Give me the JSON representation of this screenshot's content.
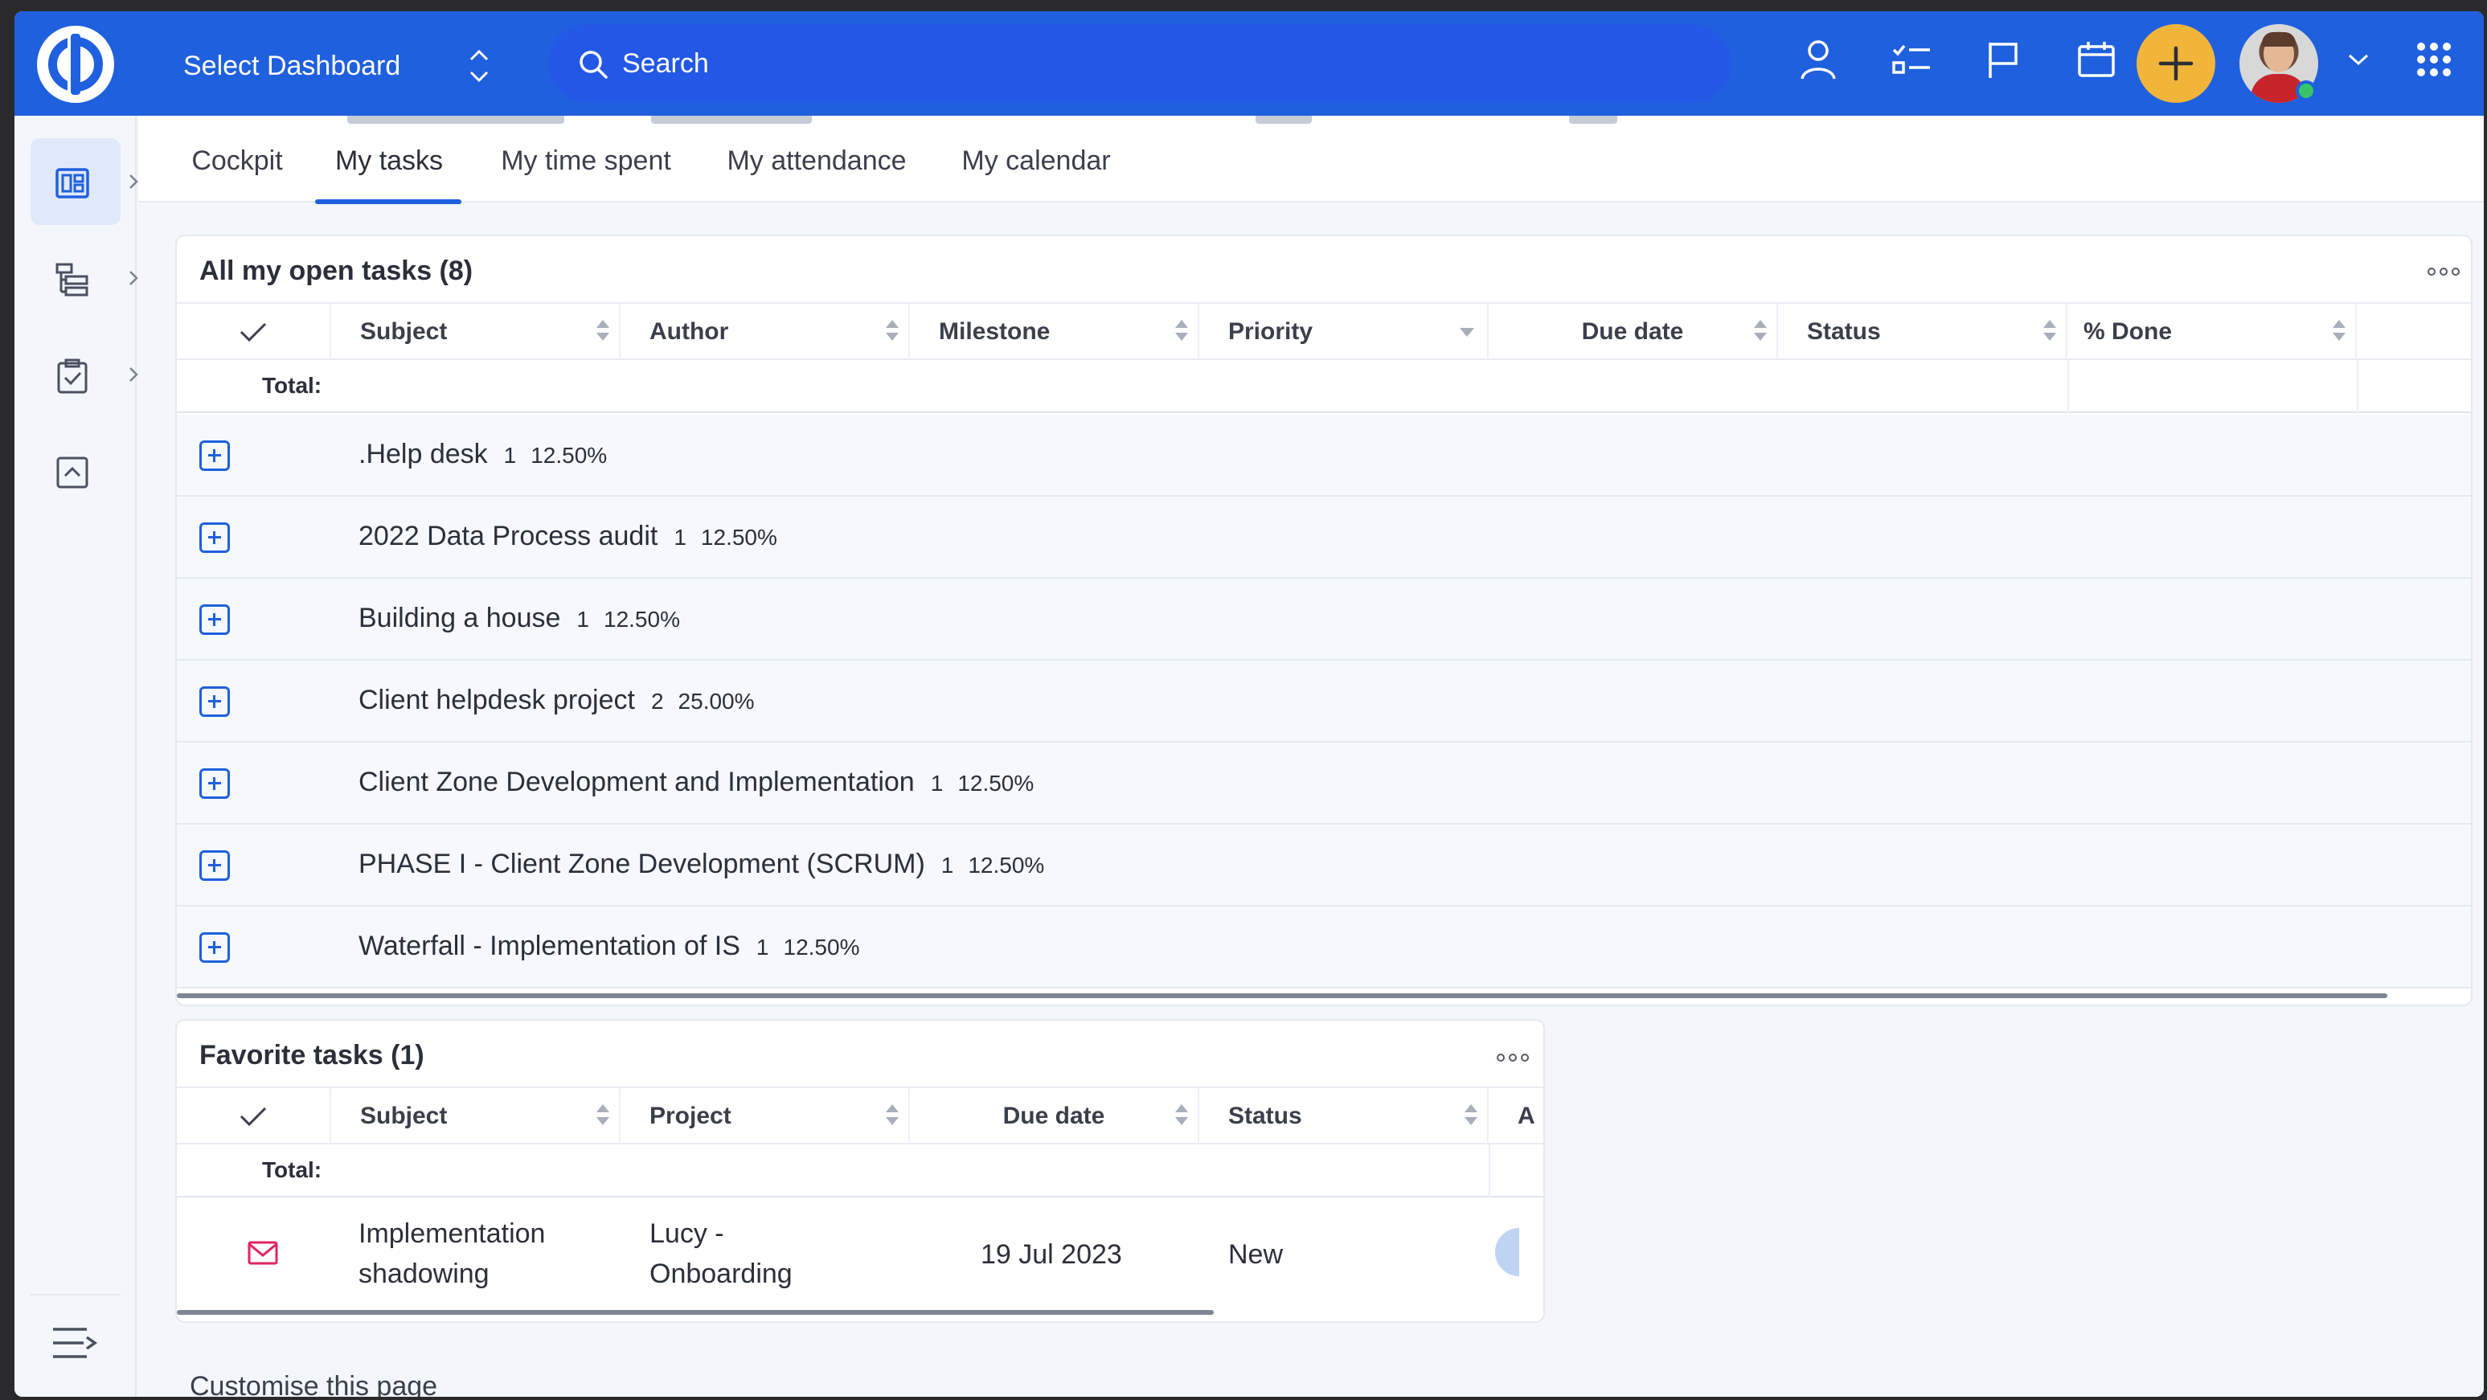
{
  "topbar": {
    "dashboard_select": "Select Dashboard",
    "search_placeholder": "Search",
    "icons": [
      "user-icon",
      "tasks-checklist-icon",
      "flag-icon",
      "calendar-icon",
      "plus-icon",
      "avatar",
      "chevron-down-icon",
      "apps-grid-icon"
    ]
  },
  "sidebar": {
    "items": [
      {
        "name": "dashboard-icon",
        "active": true
      },
      {
        "name": "list-tree-icon",
        "active": false
      },
      {
        "name": "clipboard-check-icon",
        "active": false
      },
      {
        "name": "collapse-up-icon",
        "active": false
      }
    ],
    "bottom_icon": "menu-toggle-icon"
  },
  "tabs": [
    "Cockpit",
    "My tasks",
    "My time spent",
    "My attendance",
    "My calendar"
  ],
  "active_tab": "My tasks",
  "open_tasks": {
    "title": "All my open tasks (8)",
    "columns": [
      "Subject",
      "Author",
      "Milestone",
      "Priority",
      "Due date",
      "Status",
      "% Done"
    ],
    "total_label": "Total:",
    "groups": [
      {
        "name": ".Help desk",
        "count": "1",
        "percent": "12.50%"
      },
      {
        "name": "2022 Data Process audit",
        "count": "1",
        "percent": "12.50%"
      },
      {
        "name": "Building a house",
        "count": "1",
        "percent": "12.50%"
      },
      {
        "name": "Client helpdesk project",
        "count": "2",
        "percent": "25.00%"
      },
      {
        "name": "Client Zone Development and Implementation",
        "count": "1",
        "percent": "12.50%"
      },
      {
        "name": "PHASE I - Client Zone Development (SCRUM)",
        "count": "1",
        "percent": "12.50%"
      },
      {
        "name": "Waterfall - Implementation of IS",
        "count": "1",
        "percent": "12.50%"
      }
    ]
  },
  "favorite_tasks": {
    "title": "Favorite tasks (1)",
    "columns": [
      "Subject",
      "Project",
      "Due date",
      "Status",
      "A"
    ],
    "total_label": "Total:",
    "rows": [
      {
        "subject_line1": "Implementation",
        "subject_line2": "shadowing",
        "project_line1": "Lucy -",
        "project_line2": "Onboarding",
        "due_date": "19 Jul 2023",
        "status": "New"
      }
    ]
  },
  "footer": {
    "customise": "Customise this page"
  },
  "colors": {
    "brand": "#1f60de",
    "accent": "#f1b53a",
    "mail_icon": "#e0245e"
  }
}
